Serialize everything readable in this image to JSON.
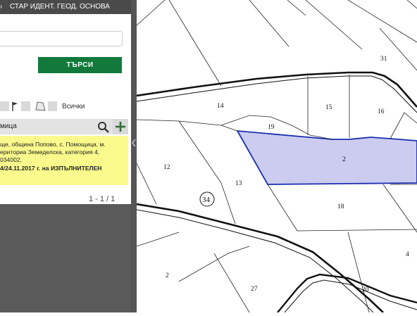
{
  "tabs": [
    "СТАР ИДЕНТ.",
    "ГЕОД. ОСНОВА"
  ],
  "search": {
    "button_label": "ТЪРСИ",
    "value": ""
  },
  "tools": {
    "all_label": "Всички"
  },
  "result": {
    "name": "мица",
    "lines": [
      "ще, община Попово, с. Помощица, м.",
      "ериториа Земеделска, категория 4,",
      "034002,",
      "4/24.11.2017 г. на ИЗПЪЛНИТЕЛЕН"
    ]
  },
  "pager": "1 - 1 / 1",
  "map": {
    "parcel_labels": [
      "31",
      "14",
      "15",
      "16",
      "19",
      "2",
      "12",
      "13",
      "18",
      "2",
      "27",
      "20",
      "4"
    ],
    "circled_label": "34",
    "selected_fill": "#ccccf0",
    "selected_stroke": "#1a2fb0"
  }
}
